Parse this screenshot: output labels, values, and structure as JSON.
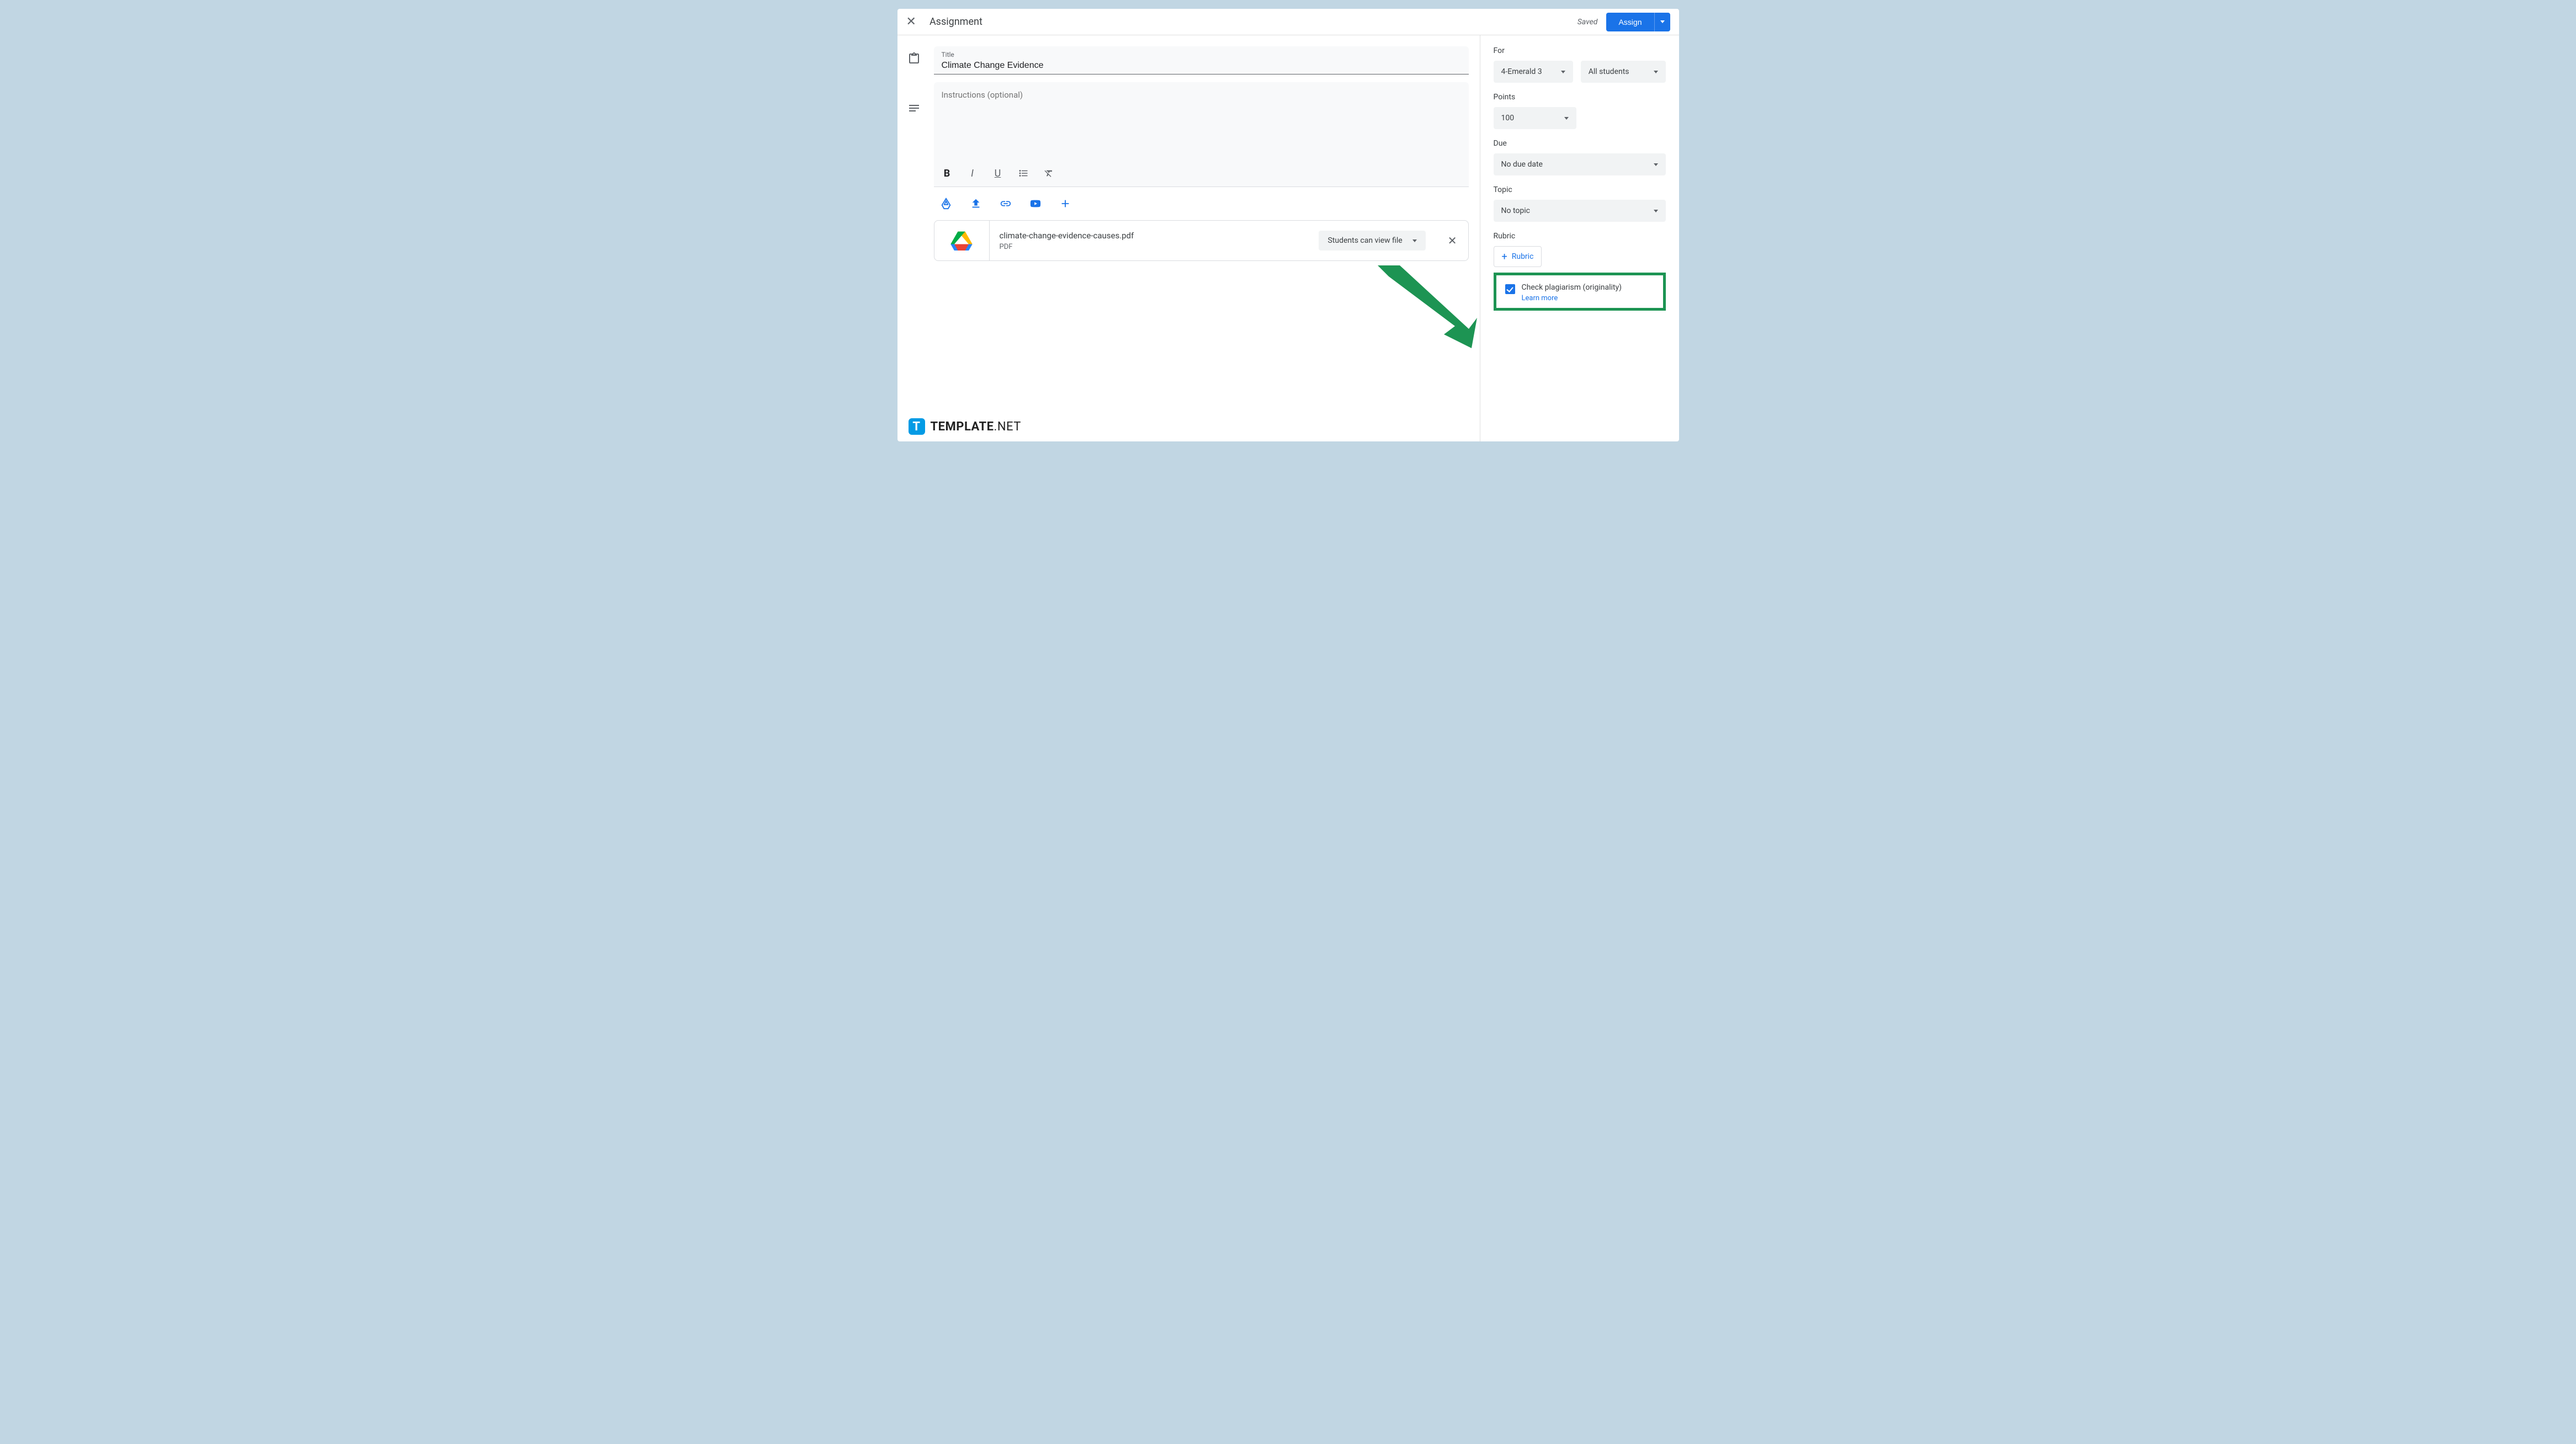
{
  "header": {
    "title": "Assignment",
    "saved": "Saved",
    "assign": "Assign"
  },
  "title_field": {
    "label": "Title",
    "value": "Climate Change Evidence"
  },
  "instructions": {
    "placeholder": "Instructions (optional)"
  },
  "attachment": {
    "name": "climate-change-evidence-causes.pdf",
    "type": "PDF",
    "permission": "Students can view file"
  },
  "sidebar": {
    "for_label": "For",
    "class": "4-Emerald 3",
    "students": "All students",
    "points_label": "Points",
    "points": "100",
    "due_label": "Due",
    "due": "No due date",
    "topic_label": "Topic",
    "topic": "No topic",
    "rubric_label": "Rubric",
    "rubric_btn": "Rubric",
    "plagiarism": "Check plagiarism (originality)",
    "learn_more": "Learn more"
  },
  "watermark": {
    "brand": "TEMPLATE",
    "suffix": ".NET"
  }
}
